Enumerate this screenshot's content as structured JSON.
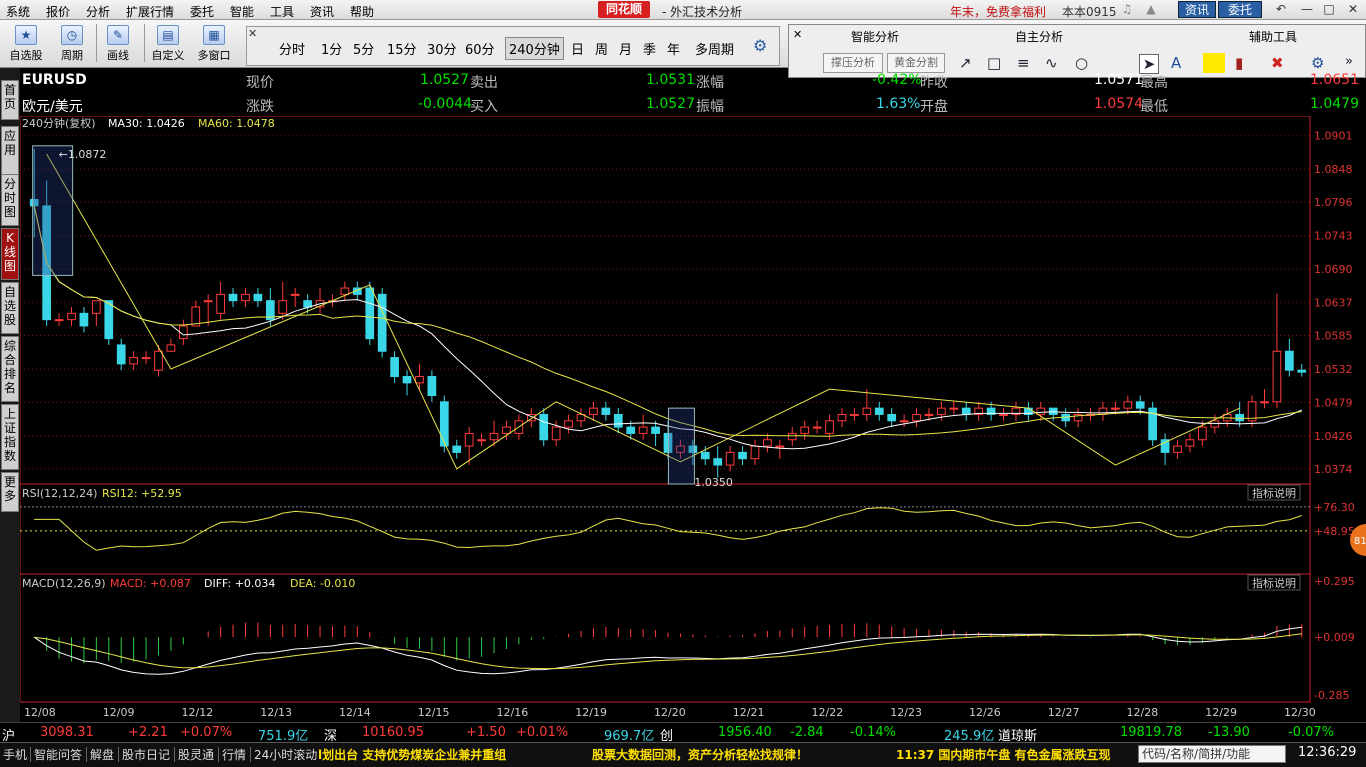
{
  "menu": [
    "系统",
    "报价",
    "分析",
    "扩展行情",
    "委托",
    "智能",
    "工具",
    "资讯",
    "帮助"
  ],
  "app": {
    "logo": "同花顺",
    "title": "- 外汇技术分析",
    "promo": "年末，免费拿福利",
    "version": "本本0915",
    "btn_news": "资讯",
    "btn_trade": "委托"
  },
  "toolbar": [
    {
      "label": "自选股",
      "icon": "star-icon"
    },
    {
      "label": "周期",
      "icon": "clock-icon"
    },
    {
      "label": "画线",
      "icon": "pencil-icon"
    },
    {
      "label": "自定义",
      "icon": "custom-icon"
    },
    {
      "label": "多窗口",
      "icon": "multiwindow-icon"
    }
  ],
  "periods": [
    "分时",
    "1分",
    "5分",
    "15分",
    "30分",
    "60分",
    "240分钟",
    "日",
    "周",
    "月",
    "季",
    "年",
    "多周期"
  ],
  "active_period": "240分钟",
  "panel": {
    "smart": "智能分析",
    "custom": "自主分析",
    "aux": "辅助工具",
    "btn_support": "撑压分析",
    "btn_golden": "黄金分割"
  },
  "sidebar": [
    "首页",
    "应用",
    "分时图",
    "K线图",
    "自选股",
    "综合排名",
    "上证指数",
    "更多"
  ],
  "quote": {
    "symbol": "EURUSD",
    "name": "欧元/美元",
    "r1": [
      {
        "label": "现价",
        "value": "1.0527"
      },
      {
        "label": "卖出",
        "value": "1.0531"
      },
      {
        "label": "涨幅",
        "value": "-0.42%"
      },
      {
        "label": "昨收",
        "value": "1.0571"
      },
      {
        "label": "最高",
        "value": "1.0651"
      }
    ],
    "r2": [
      {
        "label": "涨跌",
        "value": "-0.0044"
      },
      {
        "label": "买入",
        "value": "1.0527"
      },
      {
        "label": "振幅",
        "value": "1.63%"
      },
      {
        "label": "开盘",
        "value": "1.0574"
      },
      {
        "label": "最低",
        "value": "1.0479"
      }
    ]
  },
  "indicators": {
    "ma": {
      "period": "240分钟(复权)",
      "ma30": "MA30: 1.0426",
      "ma60": "MA60: 1.0478"
    },
    "rsi": {
      "name": "RSI(12,12,24)",
      "value": "RSI12: +52.95"
    },
    "macd": {
      "name": "MACD(12,26,9)",
      "macd": "MACD: +0.087",
      "diff": "DIFF: +0.034",
      "dea": "DEA: -0.010"
    },
    "btn": "指标说明",
    "badge": "81"
  },
  "colors": {
    "up": "#ff3b3b",
    "down": "#3ad7e8",
    "ma30": "#ffffff",
    "ma60": "#e6e64a",
    "zigzag": "#e6e64a",
    "grid": "#7a1010",
    "axis": "#cc2222"
  },
  "chart_data": {
    "type": "candlestick",
    "y_ticks": [
      "1.0901",
      "1.0848",
      "1.0796",
      "1.0743",
      "1.0690",
      "1.0637",
      "1.0585",
      "1.0532",
      "1.0479",
      "1.0426",
      "1.0374"
    ],
    "ylim": [
      1.035,
      1.091
    ],
    "x_labels": [
      "12/08",
      "12/09",
      "12/12",
      "12/13",
      "12/14",
      "12/15",
      "12/16",
      "12/19",
      "12/20",
      "12/21",
      "12/22",
      "12/23",
      "12/26",
      "12/27",
      "12/28",
      "12/29",
      "12/30"
    ],
    "annotations": {
      "high": "1.0872",
      "low": "1.0350"
    },
    "rsi_ticks": [
      "+76.30",
      "+48.95"
    ],
    "macd_ticks": [
      "+0.295",
      "+0.009",
      "-0.285"
    ],
    "candles": [
      [
        1.08,
        1.079,
        1.088,
        1.074
      ],
      [
        1.079,
        1.061,
        1.083,
        1.06
      ],
      [
        1.061,
        1.061,
        1.062,
        1.06
      ],
      [
        1.061,
        1.062,
        1.063,
        1.06
      ],
      [
        1.062,
        1.06,
        1.063,
        1.059
      ],
      [
        1.062,
        1.064,
        1.064,
        1.06
      ],
      [
        1.064,
        1.058,
        1.064,
        1.057
      ],
      [
        1.057,
        1.054,
        1.058,
        1.053
      ],
      [
        1.054,
        1.055,
        1.056,
        1.053
      ],
      [
        1.055,
        1.055,
        1.056,
        1.054
      ],
      [
        1.053,
        1.056,
        1.057,
        1.052
      ],
      [
        1.056,
        1.057,
        1.058,
        1.056
      ],
      [
        1.058,
        1.06,
        1.061,
        1.057
      ],
      [
        1.06,
        1.063,
        1.064,
        1.06
      ],
      [
        1.064,
        1.064,
        1.065,
        1.06
      ],
      [
        1.062,
        1.065,
        1.067,
        1.061
      ],
      [
        1.065,
        1.064,
        1.066,
        1.063
      ],
      [
        1.064,
        1.065,
        1.066,
        1.063
      ],
      [
        1.065,
        1.064,
        1.066,
        1.063
      ],
      [
        1.064,
        1.061,
        1.066,
        1.06
      ],
      [
        1.062,
        1.064,
        1.067,
        1.061
      ],
      [
        1.065,
        1.065,
        1.066,
        1.063
      ],
      [
        1.064,
        1.063,
        1.065,
        1.062
      ],
      [
        1.063,
        1.064,
        1.066,
        1.062
      ],
      [
        1.064,
        1.064,
        1.065,
        1.063
      ],
      [
        1.065,
        1.066,
        1.067,
        1.064
      ],
      [
        1.066,
        1.065,
        1.067,
        1.064
      ],
      [
        1.066,
        1.058,
        1.067,
        1.057
      ],
      [
        1.065,
        1.056,
        1.066,
        1.055
      ],
      [
        1.055,
        1.052,
        1.056,
        1.051
      ],
      [
        1.052,
        1.051,
        1.053,
        1.049
      ],
      [
        1.051,
        1.052,
        1.054,
        1.05
      ],
      [
        1.052,
        1.049,
        1.053,
        1.048
      ],
      [
        1.048,
        1.041,
        1.049,
        1.04
      ],
      [
        1.041,
        1.04,
        1.042,
        1.039
      ],
      [
        1.041,
        1.043,
        1.044,
        1.038
      ],
      [
        1.042,
        1.042,
        1.043,
        1.041
      ],
      [
        1.042,
        1.043,
        1.045,
        1.041
      ],
      [
        1.043,
        1.044,
        1.045,
        1.042
      ],
      [
        1.043,
        1.045,
        1.046,
        1.042
      ],
      [
        1.045,
        1.046,
        1.047,
        1.044
      ],
      [
        1.046,
        1.042,
        1.047,
        1.041
      ],
      [
        1.042,
        1.044,
        1.045,
        1.041
      ],
      [
        1.044,
        1.045,
        1.046,
        1.043
      ],
      [
        1.045,
        1.046,
        1.047,
        1.044
      ],
      [
        1.046,
        1.047,
        1.048,
        1.045
      ],
      [
        1.047,
        1.046,
        1.048,
        1.045
      ],
      [
        1.046,
        1.044,
        1.047,
        1.043
      ],
      [
        1.044,
        1.043,
        1.045,
        1.042
      ],
      [
        1.043,
        1.044,
        1.046,
        1.042
      ],
      [
        1.044,
        1.043,
        1.045,
        1.041
      ],
      [
        1.043,
        1.04,
        1.045,
        1.039
      ],
      [
        1.04,
        1.041,
        1.042,
        1.039
      ],
      [
        1.041,
        1.04,
        1.042,
        1.038
      ],
      [
        1.04,
        1.039,
        1.041,
        1.038
      ],
      [
        1.039,
        1.038,
        1.041,
        1.036
      ],
      [
        1.038,
        1.04,
        1.041,
        1.037
      ],
      [
        1.04,
        1.039,
        1.041,
        1.038
      ],
      [
        1.039,
        1.041,
        1.042,
        1.038
      ],
      [
        1.041,
        1.042,
        1.043,
        1.04
      ],
      [
        1.041,
        1.041,
        1.042,
        1.039
      ],
      [
        1.042,
        1.043,
        1.044,
        1.041
      ],
      [
        1.043,
        1.044,
        1.045,
        1.042
      ],
      [
        1.044,
        1.044,
        1.045,
        1.043
      ],
      [
        1.043,
        1.045,
        1.046,
        1.042
      ],
      [
        1.045,
        1.046,
        1.047,
        1.044
      ],
      [
        1.046,
        1.046,
        1.047,
        1.045
      ],
      [
        1.046,
        1.047,
        1.05,
        1.045
      ],
      [
        1.047,
        1.046,
        1.048,
        1.045
      ],
      [
        1.046,
        1.045,
        1.047,
        1.044
      ],
      [
        1.045,
        1.045,
        1.046,
        1.044
      ],
      [
        1.045,
        1.046,
        1.047,
        1.044
      ],
      [
        1.046,
        1.046,
        1.047,
        1.045
      ],
      [
        1.046,
        1.047,
        1.048,
        1.045
      ],
      [
        1.047,
        1.047,
        1.048,
        1.046
      ],
      [
        1.047,
        1.046,
        1.048,
        1.045
      ],
      [
        1.046,
        1.047,
        1.048,
        1.045
      ],
      [
        1.047,
        1.046,
        1.048,
        1.045
      ],
      [
        1.046,
        1.046,
        1.047,
        1.045
      ],
      [
        1.046,
        1.047,
        1.048,
        1.045
      ],
      [
        1.047,
        1.046,
        1.048,
        1.045
      ],
      [
        1.046,
        1.047,
        1.048,
        1.045
      ],
      [
        1.047,
        1.046,
        1.047,
        1.045
      ],
      [
        1.046,
        1.045,
        1.047,
        1.044
      ],
      [
        1.045,
        1.046,
        1.047,
        1.044
      ],
      [
        1.046,
        1.046,
        1.047,
        1.045
      ],
      [
        1.046,
        1.047,
        1.048,
        1.045
      ],
      [
        1.047,
        1.047,
        1.048,
        1.046
      ],
      [
        1.047,
        1.048,
        1.049,
        1.046
      ],
      [
        1.048,
        1.047,
        1.049,
        1.046
      ],
      [
        1.047,
        1.042,
        1.048,
        1.041
      ],
      [
        1.042,
        1.04,
        1.043,
        1.038
      ],
      [
        1.04,
        1.041,
        1.042,
        1.039
      ],
      [
        1.041,
        1.042,
        1.043,
        1.04
      ],
      [
        1.042,
        1.044,
        1.045,
        1.041
      ],
      [
        1.044,
        1.045,
        1.046,
        1.043
      ],
      [
        1.045,
        1.046,
        1.047,
        1.044
      ],
      [
        1.046,
        1.045,
        1.048,
        1.044
      ],
      [
        1.045,
        1.048,
        1.049,
        1.044
      ],
      [
        1.048,
        1.048,
        1.05,
        1.047
      ],
      [
        1.048,
        1.056,
        1.0651,
        1.047
      ],
      [
        1.056,
        1.053,
        1.058,
        1.052
      ],
      [
        1.053,
        1.0527,
        1.054,
        1.052
      ]
    ],
    "ma30_label": "MA30",
    "ma60_label": "MA60"
  },
  "status": {
    "sh": {
      "label": "沪",
      "price": "3098.31",
      "chg": "+2.21",
      "pct": "+0.07%",
      "vol": "751.9亿"
    },
    "sz": {
      "label": "深",
      "price": "10160.95",
      "chg": "+1.50",
      "pct": "+0.01%",
      "vol": "969.7亿"
    },
    "cy": {
      "label": "创",
      "price": "1956.40",
      "chg": "-2.84",
      "pct": "-0.14%",
      "vol": "245.9亿"
    },
    "dj": {
      "label": "道琼斯",
      "price": "19819.78",
      "chg": "-13.90",
      "pct": "-0.07%"
    }
  },
  "bottom": {
    "items": [
      "手机",
      "智能问答",
      "解盘",
      "股市日记",
      "股灵通",
      "行情",
      "24小时滚动"
    ],
    "news1": "l划出台 支持优势煤炭企业兼并重组",
    "news2": "股票大数据回测，资产分析轻松找规律！",
    "news3": "11:37 国内期市午盘 有色金属涨跌互现",
    "search": "代码/名称/简拼/功能",
    "time": "12:36:29"
  }
}
